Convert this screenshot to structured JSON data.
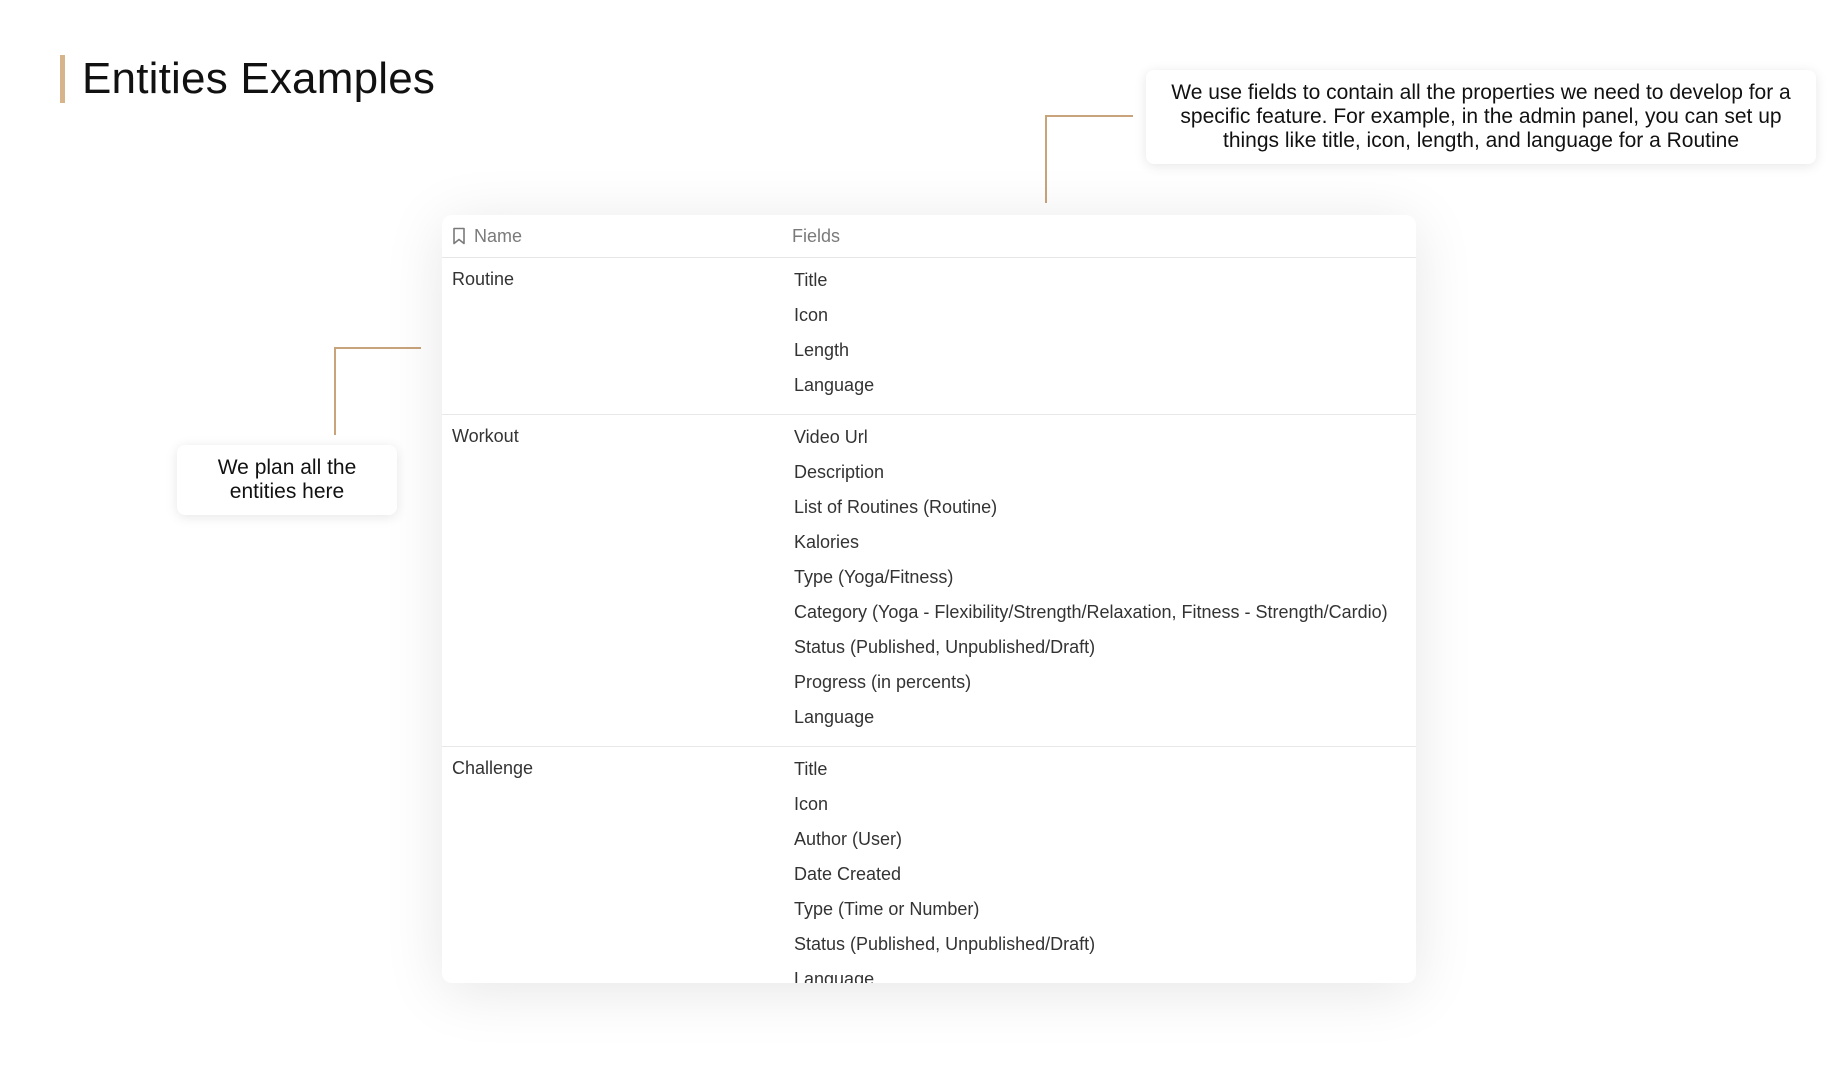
{
  "page": {
    "title": "Entities Examples"
  },
  "callouts": {
    "fields_note": "We use fields to contain all the properties we need to develop for a specific feature. For example, in the admin panel, you can set up things like title, icon, length, and language for a Routine",
    "entities_note": "We plan all the entities here"
  },
  "table": {
    "headers": {
      "name": "Name",
      "fields": "Fields"
    },
    "rows": [
      {
        "name": "Routine",
        "fields": [
          "Title",
          "Icon",
          "Length",
          "Language"
        ]
      },
      {
        "name": "Workout",
        "fields": [
          "Video Url",
          "Description",
          "List of Routines (Routine)",
          "Kalories",
          "Type (Yoga/Fitness)",
          "Category (Yoga - Flexibility/Strength/Relaxation, Fitness - Strength/Cardio)",
          "Status (Published, Unpublished/Draft)",
          "Progress (in percents)",
          "Language"
        ]
      },
      {
        "name": "Challenge",
        "fields": [
          "Title",
          "Icon",
          "Author (User)",
          "Date Created",
          "Type (Time or Number)",
          "Status (Published, Unpublished/Draft)",
          "Language"
        ]
      }
    ]
  },
  "colors": {
    "accent": "#d8b48a",
    "connector": "#c9a37a",
    "header_text": "#7a7a7a",
    "body_text": "#333333"
  },
  "icons": {
    "name_header": "bookmark-icon"
  }
}
